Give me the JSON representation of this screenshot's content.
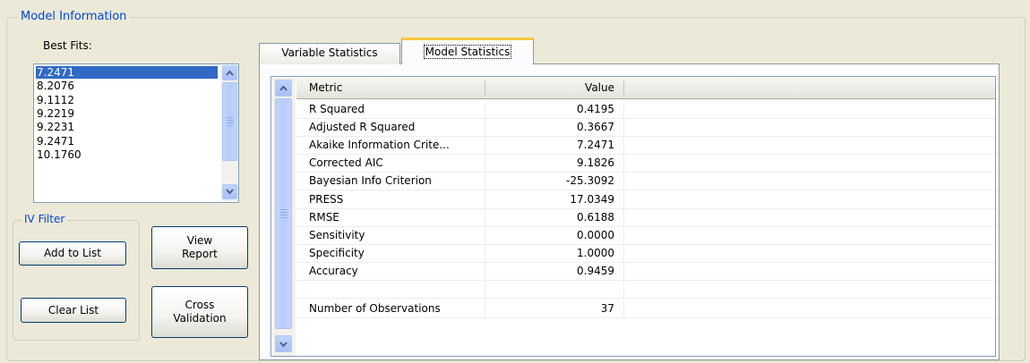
{
  "model_information": {
    "title": "Model Information",
    "best_fits_label": "Best Fits:",
    "best_fits": [
      "7.2471",
      "8.2076",
      "9.1112",
      "9.2219",
      "9.2231",
      "9.2471",
      "10.1760"
    ],
    "selected_index": 0
  },
  "iv_filter": {
    "title": "IV Filter",
    "add_to_list": "Add to List",
    "clear_list": "Clear List"
  },
  "buttons": {
    "view_report": "View\nReport",
    "cross_validation": "Cross\nValidation"
  },
  "tabs": [
    {
      "label": "Variable Statistics",
      "active": false
    },
    {
      "label": "Model Statistics",
      "active": true
    }
  ],
  "grid": {
    "headers": {
      "metric": "Metric",
      "value": "Value"
    },
    "rows": [
      {
        "metric": "R Squared",
        "value": "0.4195"
      },
      {
        "metric": "Adjusted R Squared",
        "value": "0.3667"
      },
      {
        "metric": "Akaike Information Crite...",
        "value": "7.2471"
      },
      {
        "metric": "Corrected AIC",
        "value": "9.1826"
      },
      {
        "metric": "Bayesian Info Criterion",
        "value": "-25.3092"
      },
      {
        "metric": "PRESS",
        "value": "17.0349"
      },
      {
        "metric": "RMSE",
        "value": "0.6188"
      },
      {
        "metric": "Sensitivity",
        "value": "0.0000"
      },
      {
        "metric": "Specificity",
        "value": "1.0000"
      },
      {
        "metric": "Accuracy",
        "value": "0.9459"
      },
      {
        "metric": "",
        "value": ""
      },
      {
        "metric": "Number of Observations",
        "value": "37"
      }
    ]
  },
  "colors": {
    "group_title": "#0046D5",
    "selection": "#316AC5",
    "active_tab_accent": "#FFC83C",
    "window_bg": "#ECE9D8"
  }
}
